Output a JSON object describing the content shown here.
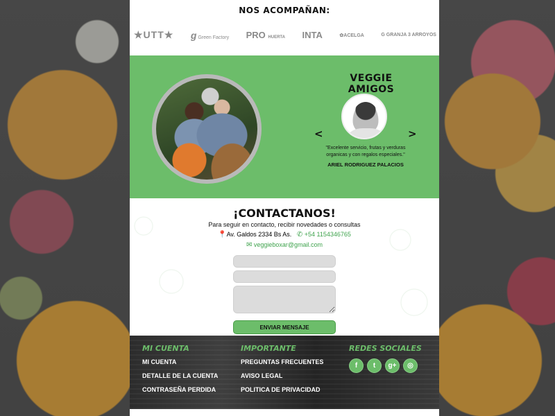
{
  "sponsors": {
    "title": "NOS ACOMPAÑAN:",
    "logos": [
      {
        "name": "UTT",
        "text": "★UTT★"
      },
      {
        "name": "Green Factory",
        "mark": "g",
        "text": "Green Factory"
      },
      {
        "name": "PRO HUERTA",
        "mark": "PRO",
        "text": "HUERTA"
      },
      {
        "name": "INTA",
        "text": "INTA"
      },
      {
        "name": "ACELGA",
        "mark": "✿",
        "text": "ACELGA"
      },
      {
        "name": "GRANJA 3 ARROYOS",
        "mark": "G",
        "text": "GRANJA 3 ARROYOS"
      }
    ]
  },
  "testimonial": {
    "title": "VEGGIE AMIGOS",
    "prev": "<",
    "next": ">",
    "quote": "\"Excelente servicio, frutas y verduras organicas y con regalos especiales.\"",
    "author": "ARIEL RODRIGUEZ PALACIOS"
  },
  "contact": {
    "title": "¡CONTACTANOS!",
    "subtitle": "Para seguir en contacto, recibir novedades o consultas",
    "address": "Av. Galdos 2334 Bs As.",
    "phone": "+54 1154346765",
    "email": "veggieboxar@gmail.com",
    "send_label": "ENVIAR MENSAJE"
  },
  "footer": {
    "col1": {
      "title": "MI CUENTA",
      "links": [
        "MI CUENTA",
        "DETALLE DE LA CUENTA",
        "CONTRASEÑA PERDIDA"
      ]
    },
    "col2": {
      "title": "IMPORTANTE",
      "links": [
        "PREGUNTAS FRECUENTES",
        "AVISO LEGAL",
        "POLITICA DE PRIVACIDAD"
      ]
    },
    "col3": {
      "title": "REDES SOCIALES",
      "icons": [
        "facebook-icon",
        "twitter-icon",
        "google-plus-icon",
        "instagram-icon"
      ]
    }
  },
  "colors": {
    "accent": "#6cbd6a",
    "contact_green": "#3fa34d",
    "footer_bg": "#2f2f2f"
  }
}
